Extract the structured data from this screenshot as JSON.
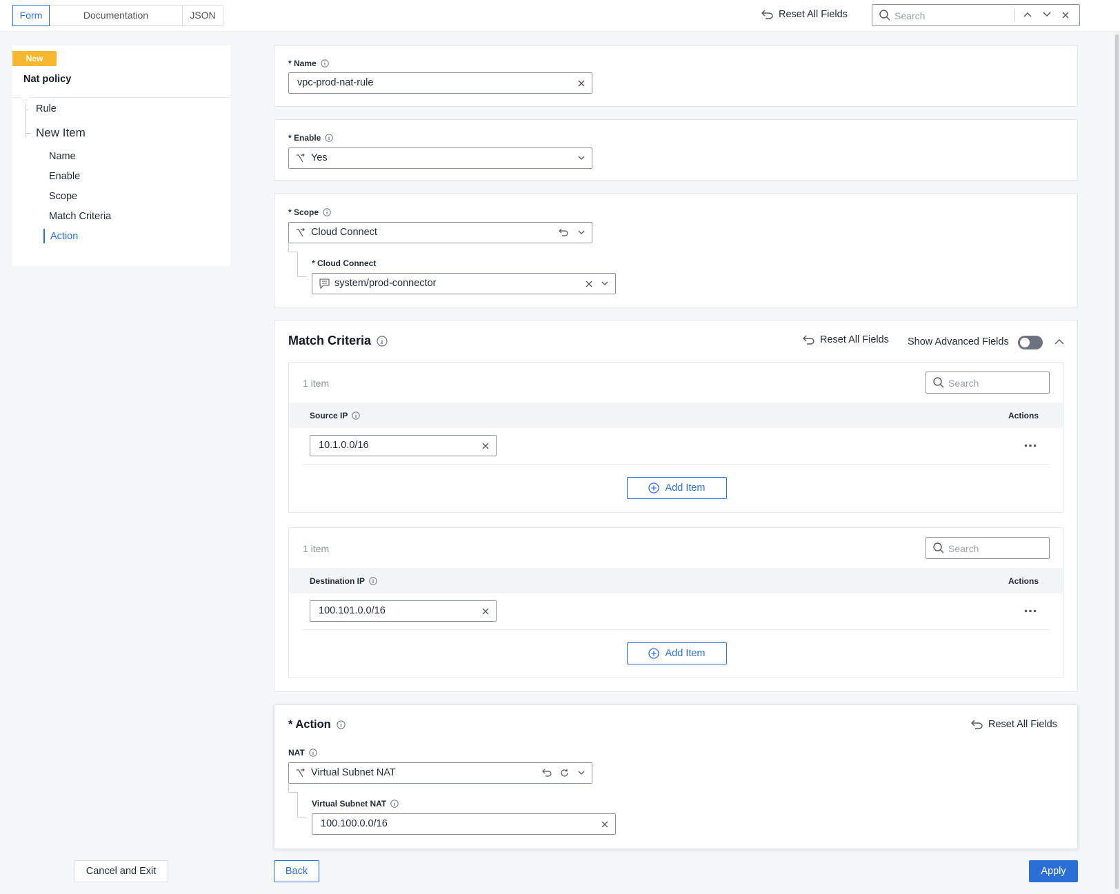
{
  "topbar": {
    "tabs": [
      "Form",
      "Documentation",
      "JSON"
    ],
    "active_tab": "Form",
    "reset_label": "Reset All Fields",
    "search_placeholder": "Search"
  },
  "sidebar": {
    "badge": "New",
    "title": "Nat policy",
    "rule": "Rule",
    "new_item": "New Item",
    "items": [
      "Name",
      "Enable",
      "Scope",
      "Match Criteria",
      "Action"
    ],
    "active_item": "Action",
    "cancel_label": "Cancel and Exit"
  },
  "name_section": {
    "label": "* Name",
    "value": "vpc-prod-nat-rule"
  },
  "enable_section": {
    "label": "* Enable",
    "value": "Yes"
  },
  "scope_section": {
    "label": "* Scope",
    "value": "Cloud Connect",
    "child_label": "* Cloud Connect",
    "child_value": "system/prod-connector"
  },
  "match_criteria": {
    "title": "Match Criteria",
    "reset_label": "Reset All Fields",
    "advanced_label": "Show Advanced Fields",
    "advanced_enabled": false,
    "source": {
      "count": "1 item",
      "search_placeholder": "Search",
      "column": "Source IP",
      "actions": "Actions",
      "rows": [
        "10.1.0.0/16"
      ],
      "add_label": "Add Item"
    },
    "destination": {
      "count": "1 item",
      "search_placeholder": "Search",
      "column": "Destination IP",
      "actions": "Actions",
      "rows": [
        "100.101.0.0/16"
      ],
      "add_label": "Add Item"
    }
  },
  "action": {
    "title": "* Action",
    "reset_label": "Reset All Fields",
    "nat_label": "NAT",
    "nat_value": "Virtual Subnet NAT",
    "child_label": "Virtual Subnet NAT",
    "child_value": "100.100.0.0/16"
  },
  "footer": {
    "back_label": "Back",
    "apply_label": "Apply"
  },
  "colors": {
    "accent": "#2b6fd6",
    "badge": "#f7b731",
    "toggle_off": "#6b7280"
  }
}
